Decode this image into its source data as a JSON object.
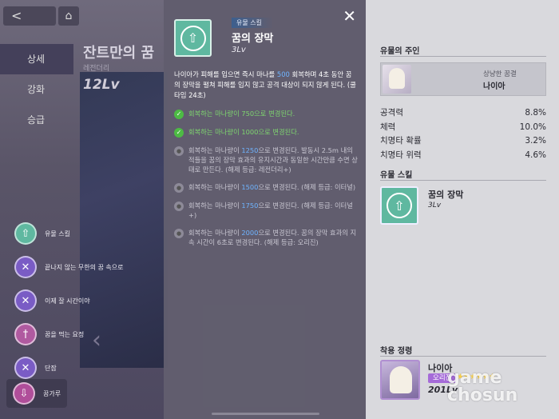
{
  "nav": {
    "back_glyph": "<",
    "home_glyph": "⌂"
  },
  "background": {
    "title": "잔트만의 꿈",
    "sub": "레전더리",
    "level": "12Lv"
  },
  "side_tabs": [
    "상세",
    "강화",
    "승급"
  ],
  "skills": [
    {
      "label": "유물 스킬",
      "color": "#5fb8a0",
      "icon": "up-arrow-icon",
      "glyph": "⇧"
    },
    {
      "label": "끝나지 않는 무한의 꿈 속으로",
      "color": "#7a5cc5",
      "icon": "crossed-swords-icon",
      "glyph": "✕"
    },
    {
      "label": "이제 잘 시간이야",
      "color": "#7a5cc5",
      "icon": "crossed-swords-icon",
      "glyph": "✕"
    },
    {
      "label": "꿈을 먹는 요정",
      "color": "#b05aa0",
      "icon": "sword-icon",
      "glyph": "†"
    },
    {
      "label": "단잠",
      "color": "#7a5cc5",
      "icon": "crossed-swords-icon",
      "glyph": "✕"
    },
    {
      "label": "꿈가루",
      "color": "#b04e9a",
      "icon": "down-arrow-icon",
      "glyph": "⇩"
    }
  ],
  "modal": {
    "tag": "유물 스킬",
    "name": "꿈의 장막",
    "level": "3Lv",
    "close": "✕",
    "desc_parts": [
      "나이아가 피해를 입으면 즉시 마나를 ",
      "500",
      " 회복하며 4초 동안 꿈의 장막을 펼쳐 피해를 입지 않고 공격 대상이 되지 않게 된다. (쿨타임 24초)"
    ],
    "upgrades": [
      {
        "state": "done",
        "text": "회복하는 마나량이 750으로 변경된다."
      },
      {
        "state": "done",
        "text": "회복하는 마나량이 1000으로 변경된다."
      },
      {
        "state": "locked",
        "pre": "회복하는 마나량이 ",
        "num": "1250",
        "post": "으로 변경된다. 발동시 2.5m 내의 적들을 꿈의 장막 효과의 유지시간과 동일한 시간만큼 수면 상태로 만든다. (해제 등급: 레전더리+)"
      },
      {
        "state": "locked",
        "pre": "회복하는 마나량이 ",
        "num": "1500",
        "post": "으로 변경된다. (해제 등급: 이터널)"
      },
      {
        "state": "locked",
        "pre": "회복하는 마나량이 ",
        "num": "1750",
        "post": "으로 변경된다. (해제 등급: 이터널+)"
      },
      {
        "state": "locked",
        "pre": "회복하는 마나량이 ",
        "num": "2000",
        "post": "으로 변경된다. 꿈의 장막 효과의 지속 시간이 6초로 변경된다. (해제 등급: 오리진)"
      }
    ]
  },
  "right": {
    "owner_title": "유물의 주인",
    "owner_sub": "상냥한 꿈결",
    "owner_name": "나이아",
    "stats": [
      {
        "label": "공격력",
        "value": "8.8%"
      },
      {
        "label": "체력",
        "value": "10.0%"
      },
      {
        "label": "치명타 확률",
        "value": "3.2%"
      },
      {
        "label": "치명타 위력",
        "value": "4.6%"
      }
    ],
    "skill_title": "유물 스킬",
    "skill_name": "꿈의 장막",
    "skill_lv": "3Lv",
    "equip_title": "착용 정령",
    "equip_name": "나이아",
    "equip_badge": "오리진",
    "equip_stars": "★★★★★★",
    "equip_lv": "201Lv"
  },
  "watermark": "game chosun"
}
